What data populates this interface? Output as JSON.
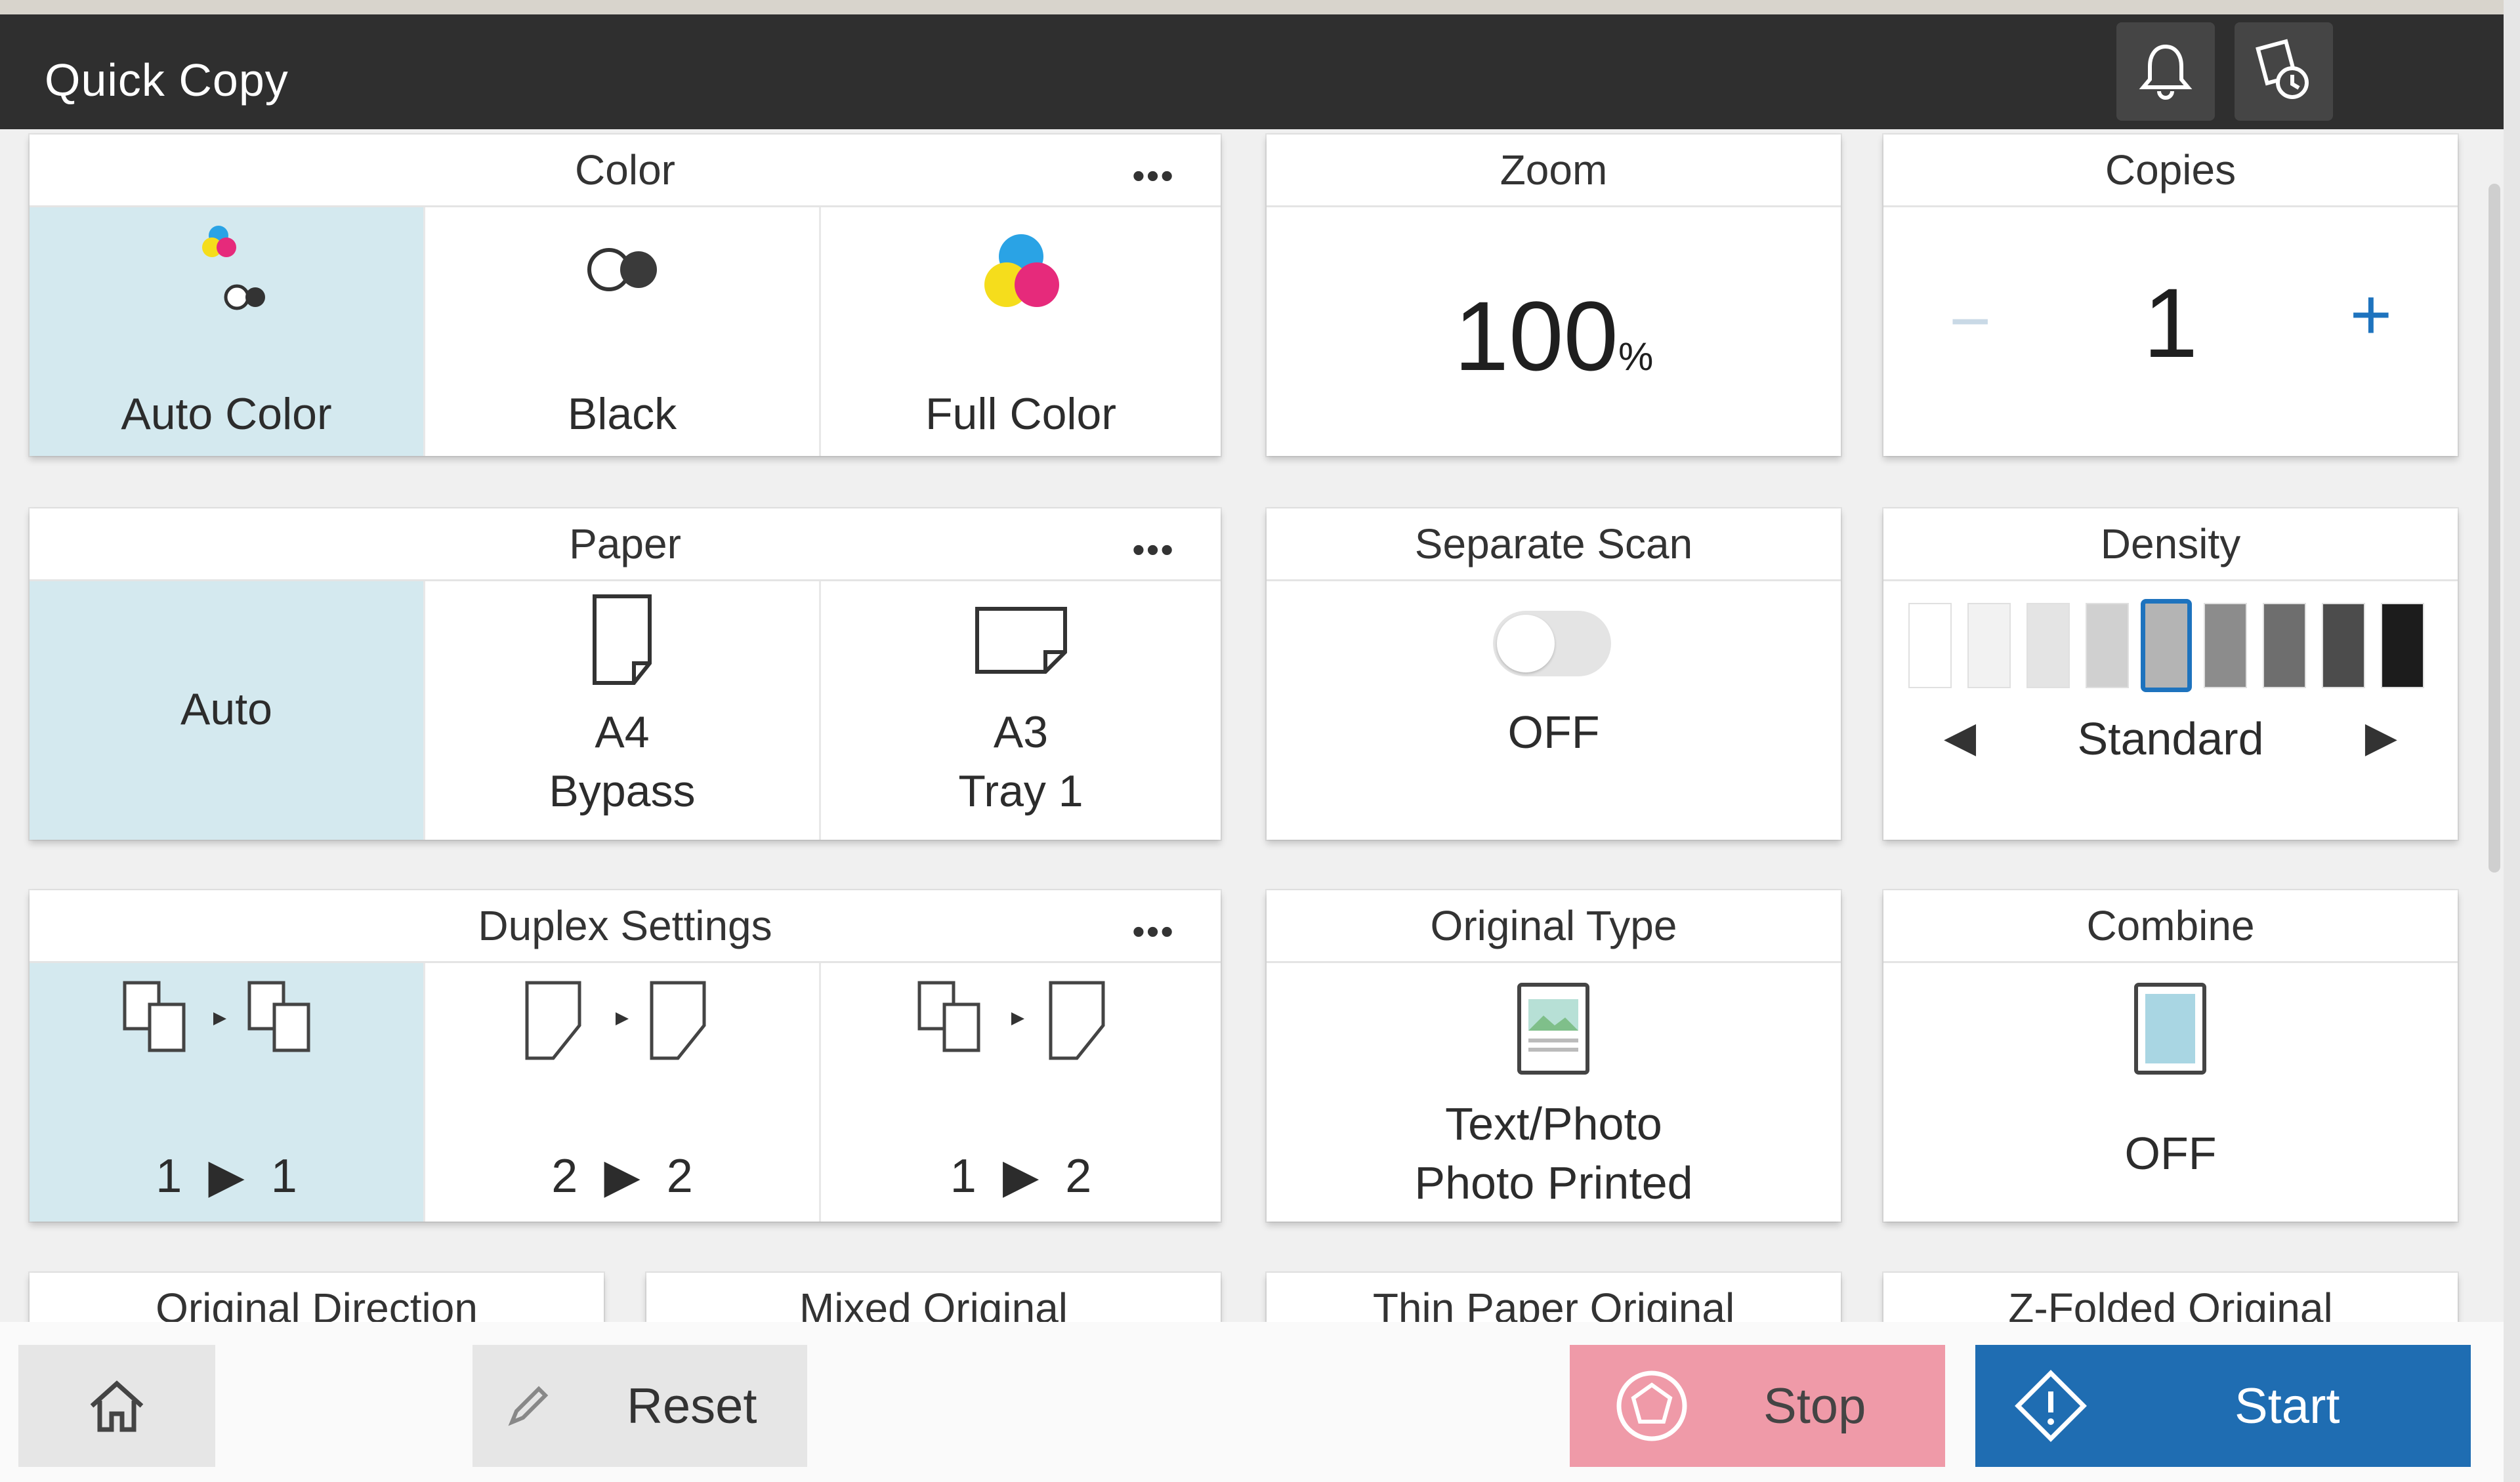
{
  "header": {
    "title": "Quick Copy"
  },
  "icons": {
    "notification": "bell-icon",
    "job_status": "job-history-icon"
  },
  "panels": {
    "color": {
      "title": "Color",
      "more": "•••",
      "options": [
        {
          "label": "Auto Color",
          "selected": true,
          "icon": "auto-color-icon"
        },
        {
          "label": "Black",
          "selected": false,
          "icon": "black-icon"
        },
        {
          "label": "Full Color",
          "selected": false,
          "icon": "full-color-icon"
        }
      ]
    },
    "zoom": {
      "title": "Zoom",
      "value": "100",
      "unit": "%"
    },
    "copies": {
      "title": "Copies",
      "value": "1",
      "minus": "−",
      "plus": "+"
    },
    "paper": {
      "title": "Paper",
      "more": "•••",
      "options": [
        {
          "label": "Auto",
          "selected": true
        },
        {
          "line1": "A4",
          "line2": "Bypass",
          "selected": false,
          "icon": "paper-sheet-icon"
        },
        {
          "line1": "A3",
          "line2": "Tray 1",
          "selected": false,
          "icon": "paper-sheet-landscape-icon"
        }
      ]
    },
    "separate_scan": {
      "title": "Separate Scan",
      "state": "OFF"
    },
    "density": {
      "title": "Density",
      "value": "Standard",
      "level": 5,
      "levels": 9
    },
    "duplex": {
      "title": "Duplex Settings",
      "more": "•••",
      "options": [
        {
          "from": "1",
          "to": "1",
          "selected": true
        },
        {
          "from": "2",
          "to": "2",
          "selected": false
        },
        {
          "from": "1",
          "to": "2",
          "selected": false
        }
      ],
      "arrow": "▶"
    },
    "original_type": {
      "title": "Original Type",
      "line1": "Text/Photo",
      "line2": "Photo Printed"
    },
    "combine": {
      "title": "Combine",
      "state": "OFF"
    },
    "partial": [
      "Original Direction",
      "Mixed Original",
      "Thin Paper Original",
      "Z-Folded Original"
    ]
  },
  "bottom": {
    "reset": "Reset",
    "stop": "Stop",
    "start": "Start"
  },
  "colors": {
    "selected": "#d4e9ef",
    "accent": "#1e73be",
    "start": "#1f6db2",
    "stop": "#ef9aa8",
    "titlebar": "#2f2f2f"
  }
}
